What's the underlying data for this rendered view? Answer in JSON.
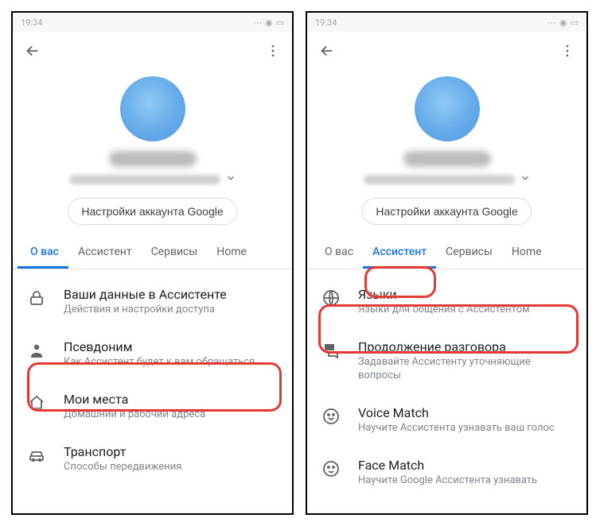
{
  "statusbar": {
    "time": "19:34"
  },
  "account_button": "Настройки аккаунта Google",
  "tabs": {
    "about": "О вас",
    "assistant": "Ассистент",
    "services": "Сервисы",
    "home": "Home"
  },
  "screen1": {
    "items": [
      {
        "title": "Ваши данные в Ассистенте",
        "sub": "Действия и настройки доступа"
      },
      {
        "title": "Псевдоним",
        "sub": "Как Ассистент будет к вам обращаться"
      },
      {
        "title": "Мои места",
        "sub": "Домашний и рабочий адреса"
      },
      {
        "title": "Транспорт",
        "sub": "Способы передвижения"
      }
    ]
  },
  "screen2": {
    "items": [
      {
        "title": "Языки",
        "sub": "Языки для общения с Ассистентом"
      },
      {
        "title": "Продолжение разговора",
        "sub": "Задавайте Ассистенту уточняющие вопросы"
      },
      {
        "title": "Voice Match",
        "sub": "Научите Ассистента узнавать ваш голос"
      },
      {
        "title": "Face Match",
        "sub": "Научите Google Ассистента узнавать"
      }
    ]
  }
}
